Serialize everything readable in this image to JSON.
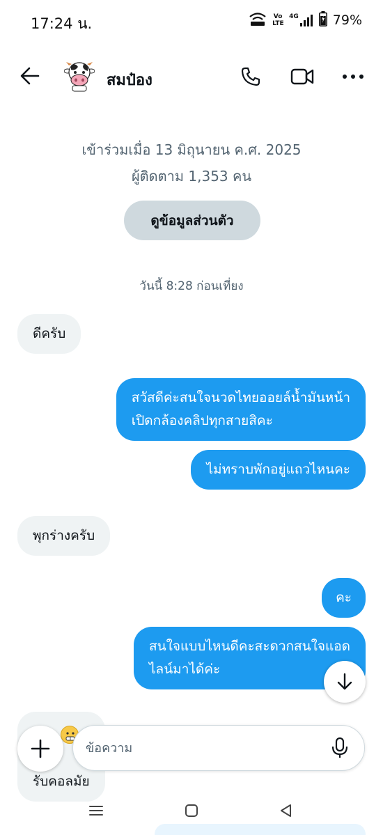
{
  "status_bar": {
    "time": "17:24 น.",
    "network_label": "4G",
    "volte_label": "Vo LTE",
    "battery": "79%"
  },
  "header": {
    "contact_name": "สมป๋อง",
    "icons": [
      "back-arrow-icon",
      "phone-icon",
      "video-camera-icon",
      "more-icon"
    ]
  },
  "profile": {
    "joined": "เข้าร่วมเมื่อ 13 มิถุนายน ค.ศ. 2025",
    "followers": "ผู้ติดตาม 1,353 คน",
    "button_label": "ดูข้อมูลส่วนตัว"
  },
  "conversation": {
    "timestamp": "วันนี้ 8:28 ก่อนเที่ยง",
    "messages": [
      {
        "direction": "in",
        "lines": [
          "ดีครับ"
        ]
      },
      {
        "direction": "out",
        "lines": [
          "สวัสดีค่ะสนใจนวดไทยออยล์น้ำมันหน้า",
          "เปิดกล้องคลิปทุกสายสิคะ"
        ]
      },
      {
        "direction": "out",
        "lines": [
          "ไม่ทราบพักอยู่แถวไหนคะ"
        ]
      },
      {
        "direction": "in",
        "lines": [
          "พุกร่างครับ"
        ]
      },
      {
        "direction": "out",
        "lines": [
          "คะ"
        ]
      },
      {
        "direction": "out",
        "lines": [
          "สนใจแบบไหนดีคะสะดวกสนใจแอด",
          "ไลน์มาได้ค่ะ"
        ]
      },
      {
        "direction": "in",
        "lines": [
          "รับคอลมัย"
        ]
      }
    ]
  },
  "composer": {
    "placeholder": "ข้อความ",
    "value": ""
  },
  "nav": {
    "icons": [
      "recent-apps-icon",
      "home-icon",
      "back-triangle-icon"
    ]
  },
  "colors": {
    "accent": "#1d9bf0",
    "incoming_bubble": "#eff3f4",
    "secondary_text": "#536471"
  }
}
